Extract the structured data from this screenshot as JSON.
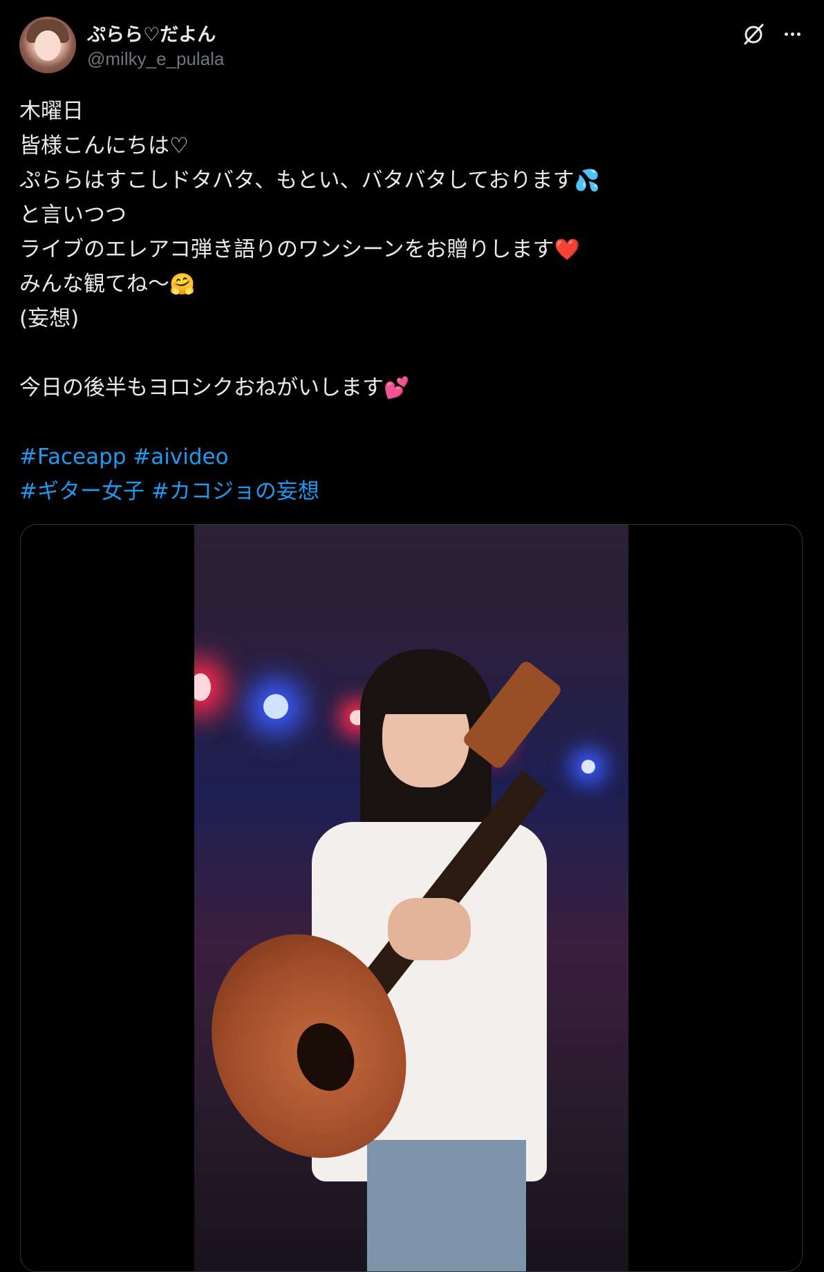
{
  "author": {
    "display_name": "ぷらら♡だよん",
    "handle": "@milky_e_pulala"
  },
  "header_actions": {
    "grok_icon": "grok-icon",
    "more_icon": "more-icon"
  },
  "tweet": {
    "lines": [
      "木曜日",
      "皆様こんにちは♡",
      "ぷららはすこしドタバタ、もとい、バタバタしております",
      "と言いつつ",
      "ライブのエレアコ弾き語りのワンシーンをお贈りします",
      "みんな観てね〜",
      "(妄想)",
      "",
      "今日の後半もヨロシクおねがいします"
    ],
    "emojis": {
      "sweat": "💦",
      "heart": "❤️",
      "hug": "🤗",
      "two_hearts": "💕"
    },
    "hashtags_line1": [
      "#Faceapp",
      "#aivideo"
    ],
    "hashtags_line2": [
      "#ギター女子",
      "#カコジョの妄想"
    ]
  },
  "colors": {
    "background": "#000000",
    "text": "#e7e9ea",
    "secondary": "#71767b",
    "link": "#1d9bf0",
    "border": "#2f3336"
  }
}
